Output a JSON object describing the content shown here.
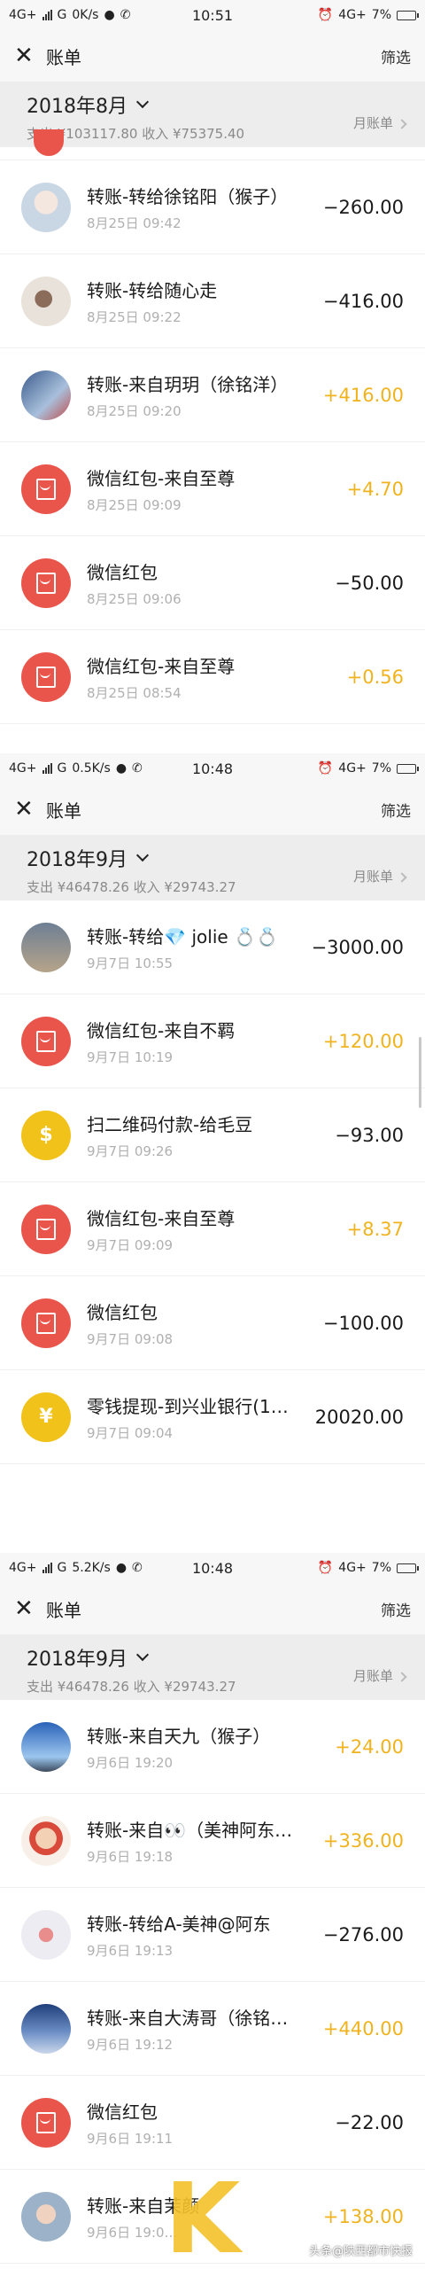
{
  "panels": [
    {
      "status": {
        "net": "4G+",
        "net2": "G",
        "speed": "0K/s",
        "time": "10:51",
        "net_right": "4G+",
        "battery": "7%"
      },
      "header": {
        "title": "账单",
        "filter": "筛选"
      },
      "month": {
        "label": "2018年8月",
        "summary": "支出 ¥103117.80 收入 ¥75375.40",
        "monthly": "月账单"
      },
      "rows": [
        {
          "avatar": "photo1",
          "name": "转账-转给徐铭阳（猴子）",
          "time": "8月25日 09:42",
          "amount": "−260.00",
          "income": false
        },
        {
          "avatar": "photo2",
          "name": "转账-转给随心走",
          "time": "8月25日 09:22",
          "amount": "−416.00",
          "income": false
        },
        {
          "avatar": "photo3",
          "name": "转账-来自玥玥（徐铭洋）",
          "time": "8月25日 09:20",
          "amount": "+416.00",
          "income": true
        },
        {
          "avatar": "redpacket",
          "name": "微信红包-来自至尊",
          "time": "8月25日 09:09",
          "amount": "+4.70",
          "income": true
        },
        {
          "avatar": "redpacket",
          "name": "微信红包",
          "time": "8月25日 09:06",
          "amount": "−50.00",
          "income": false
        },
        {
          "avatar": "redpacket",
          "name": "微信红包-来自至尊",
          "time": "8月25日 08:54",
          "amount": "+0.56",
          "income": true
        }
      ]
    },
    {
      "status": {
        "net": "4G+",
        "net2": "G",
        "speed": "0.5K/s",
        "time": "10:48",
        "net_right": "4G+",
        "battery": "7%"
      },
      "header": {
        "title": "账单",
        "filter": "筛选"
      },
      "month": {
        "label": "2018年9月",
        "summary": "支出 ¥46478.26 收入 ¥29743.27",
        "monthly": "月账单"
      },
      "rows": [
        {
          "avatar": "photo4",
          "name": "转账-转给💎 jolie 💍💍",
          "time": "9月7日 10:55",
          "amount": "−3000.00",
          "income": false
        },
        {
          "avatar": "redpacket",
          "name": "微信红包-来自不羁",
          "time": "9月7日 10:19",
          "amount": "+120.00",
          "income": true
        },
        {
          "avatar": "yellow",
          "icon": "$",
          "name": "扫二维码付款-给毛豆",
          "time": "9月7日 09:26",
          "amount": "−93.00",
          "income": false
        },
        {
          "avatar": "redpacket",
          "name": "微信红包-来自至尊",
          "time": "9月7日 09:09",
          "amount": "+8.37",
          "income": true
        },
        {
          "avatar": "redpacket",
          "name": "微信红包",
          "time": "9月7日 09:08",
          "amount": "−100.00",
          "income": false
        },
        {
          "avatar": "yellow",
          "icon": "¥",
          "name": "零钱提现-到兴业银行(1…",
          "time": "9月7日 09:04",
          "amount": "20020.00",
          "income": false
        }
      ]
    },
    {
      "status": {
        "net": "4G+",
        "net2": "G",
        "speed": "5.2K/s",
        "time": "10:48",
        "net_right": "4G+",
        "battery": "7%"
      },
      "header": {
        "title": "账单",
        "filter": "筛选"
      },
      "month": {
        "label": "2018年9月",
        "summary": "支出 ¥46478.26 收入 ¥29743.27",
        "monthly": "月账单"
      },
      "rows": [
        {
          "avatar": "photo5",
          "name": "转账-来自天九（猴子）",
          "time": "9月6日 19:20",
          "amount": "+24.00",
          "income": true
        },
        {
          "avatar": "photo6",
          "name": "转账-来自👀（美神阿东…",
          "time": "9月6日 19:18",
          "amount": "+336.00",
          "income": true
        },
        {
          "avatar": "photo7",
          "name": "转账-转给A-美神@阿东",
          "time": "9月6日 19:13",
          "amount": "−276.00",
          "income": false
        },
        {
          "avatar": "photo8",
          "name": "转账-来自大涛哥（徐铭…",
          "time": "9月6日 19:12",
          "amount": "+440.00",
          "income": true
        },
        {
          "avatar": "redpacket",
          "name": "微信红包",
          "time": "9月6日 19:11",
          "amount": "−22.00",
          "income": false
        },
        {
          "avatar": "photo9",
          "name": "转账-来自茉颜",
          "time": "9月6日 19:0…",
          "amount": "+138.00",
          "income": true
        }
      ]
    }
  ],
  "watermark": "头条@陕西都市快报"
}
